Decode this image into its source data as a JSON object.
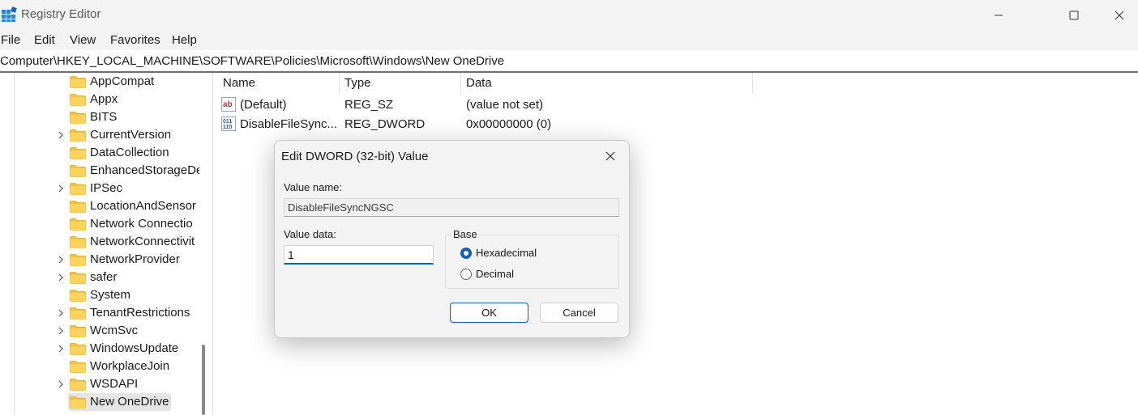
{
  "window": {
    "title": "Registry Editor",
    "controls": {
      "minimize": "minimize-icon",
      "maximize": "maximize-icon",
      "close": "close-icon"
    }
  },
  "menu": [
    "File",
    "Edit",
    "View",
    "Favorites",
    "Help"
  ],
  "address": "Computer\\HKEY_LOCAL_MACHINE\\SOFTWARE\\Policies\\Microsoft\\Windows\\New OneDrive",
  "tree": [
    {
      "label": "AppCompat",
      "expandable": false
    },
    {
      "label": "Appx",
      "expandable": false
    },
    {
      "label": "BITS",
      "expandable": false
    },
    {
      "label": "CurrentVersion",
      "expandable": true
    },
    {
      "label": "DataCollection",
      "expandable": false
    },
    {
      "label": "EnhancedStorageDe",
      "expandable": false
    },
    {
      "label": "IPSec",
      "expandable": true
    },
    {
      "label": "LocationAndSensor",
      "expandable": false
    },
    {
      "label": "Network Connectio",
      "expandable": false
    },
    {
      "label": "NetworkConnectivit",
      "expandable": false
    },
    {
      "label": "NetworkProvider",
      "expandable": true
    },
    {
      "label": "safer",
      "expandable": true
    },
    {
      "label": "System",
      "expandable": false
    },
    {
      "label": "TenantRestrictions",
      "expandable": true
    },
    {
      "label": "WcmSvc",
      "expandable": true
    },
    {
      "label": "WindowsUpdate",
      "expandable": true
    },
    {
      "label": "WorkplaceJoin",
      "expandable": false
    },
    {
      "label": "WSDAPI",
      "expandable": true
    },
    {
      "label": "New OneDrive",
      "expandable": false,
      "selected": true
    }
  ],
  "list": {
    "columns": [
      "Name",
      "Type",
      "Data"
    ],
    "rows": [
      {
        "icon": "string-value-icon",
        "name": "(Default)",
        "type": "REG_SZ",
        "data": "(value not set)"
      },
      {
        "icon": "binary-value-icon",
        "name": "DisableFileSync...",
        "type": "REG_DWORD",
        "data": "0x00000000 (0)"
      }
    ]
  },
  "dialog": {
    "title": "Edit DWORD (32-bit) Value",
    "value_name_label": "Value name:",
    "value_name": "DisableFileSyncNGSC",
    "value_data_label": "Value data:",
    "value_data": "1",
    "base_label": "Base",
    "base_options": [
      {
        "label": "Hexadecimal",
        "checked": true
      },
      {
        "label": "Decimal",
        "checked": false
      }
    ],
    "ok_label": "OK",
    "cancel_label": "Cancel"
  },
  "colors": {
    "accent": "#0f5fb8",
    "folder": "#f5c342",
    "chrome": "#f3f3f3"
  }
}
